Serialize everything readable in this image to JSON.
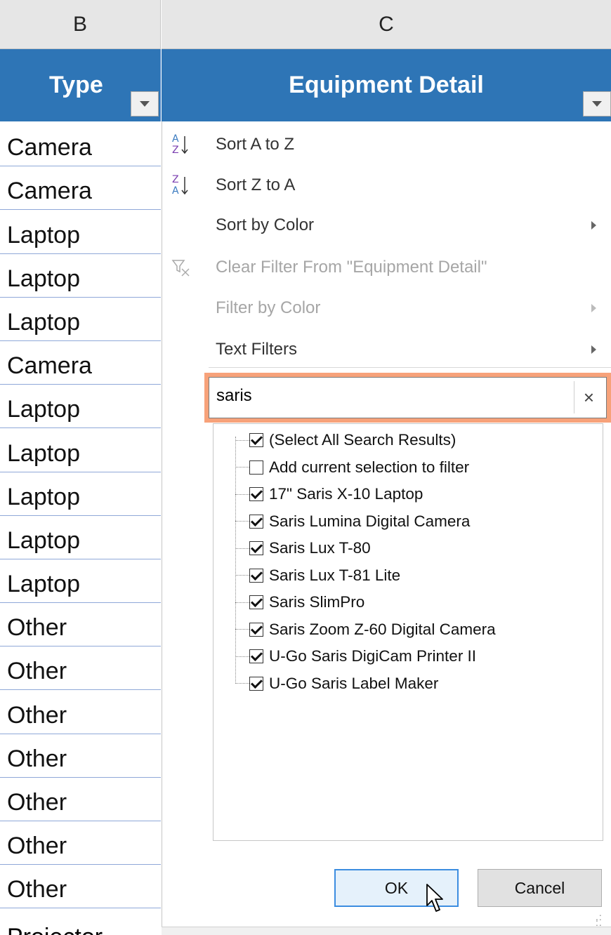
{
  "columns": {
    "b": "B",
    "c": "C"
  },
  "headers": {
    "type": "Type",
    "detail": "Equipment Detail"
  },
  "type_rows": [
    "Camera",
    "Camera",
    "Laptop",
    "Laptop",
    "Laptop",
    "Camera",
    "Laptop",
    "Laptop",
    "Laptop",
    "Laptop",
    "Laptop",
    "Other",
    "Other",
    "Other",
    "Other",
    "Other",
    "Other",
    "Other"
  ],
  "type_row_cut": "Projector",
  "menu": {
    "sort_az": "Sort A to Z",
    "sort_za": "Sort Z to A",
    "sort_color": "Sort by Color",
    "clear_filter": "Clear Filter From \"Equipment Detail\"",
    "filter_color": "Filter by Color",
    "text_filters": "Text Filters"
  },
  "search": {
    "value": "saris",
    "clear": "×"
  },
  "list": [
    {
      "label": "(Select All Search Results)",
      "checked": true
    },
    {
      "label": "Add current selection to filter",
      "checked": false
    },
    {
      "label": "17\" Saris X-10 Laptop",
      "checked": true
    },
    {
      "label": "Saris Lumina Digital Camera",
      "checked": true
    },
    {
      "label": "Saris Lux T-80",
      "checked": true
    },
    {
      "label": "Saris Lux T-81 Lite",
      "checked": true
    },
    {
      "label": "Saris SlimPro",
      "checked": true
    },
    {
      "label": "Saris Zoom Z-60 Digital Camera",
      "checked": true
    },
    {
      "label": "U-Go Saris DigiCam Printer II",
      "checked": true
    },
    {
      "label": "U-Go Saris Label Maker",
      "checked": true
    }
  ],
  "buttons": {
    "ok": "OK",
    "cancel": "Cancel"
  },
  "colors": {
    "header_bg": "#2e75b6",
    "search_highlight": "#f7a27a",
    "ok_border": "#3c8de0"
  }
}
